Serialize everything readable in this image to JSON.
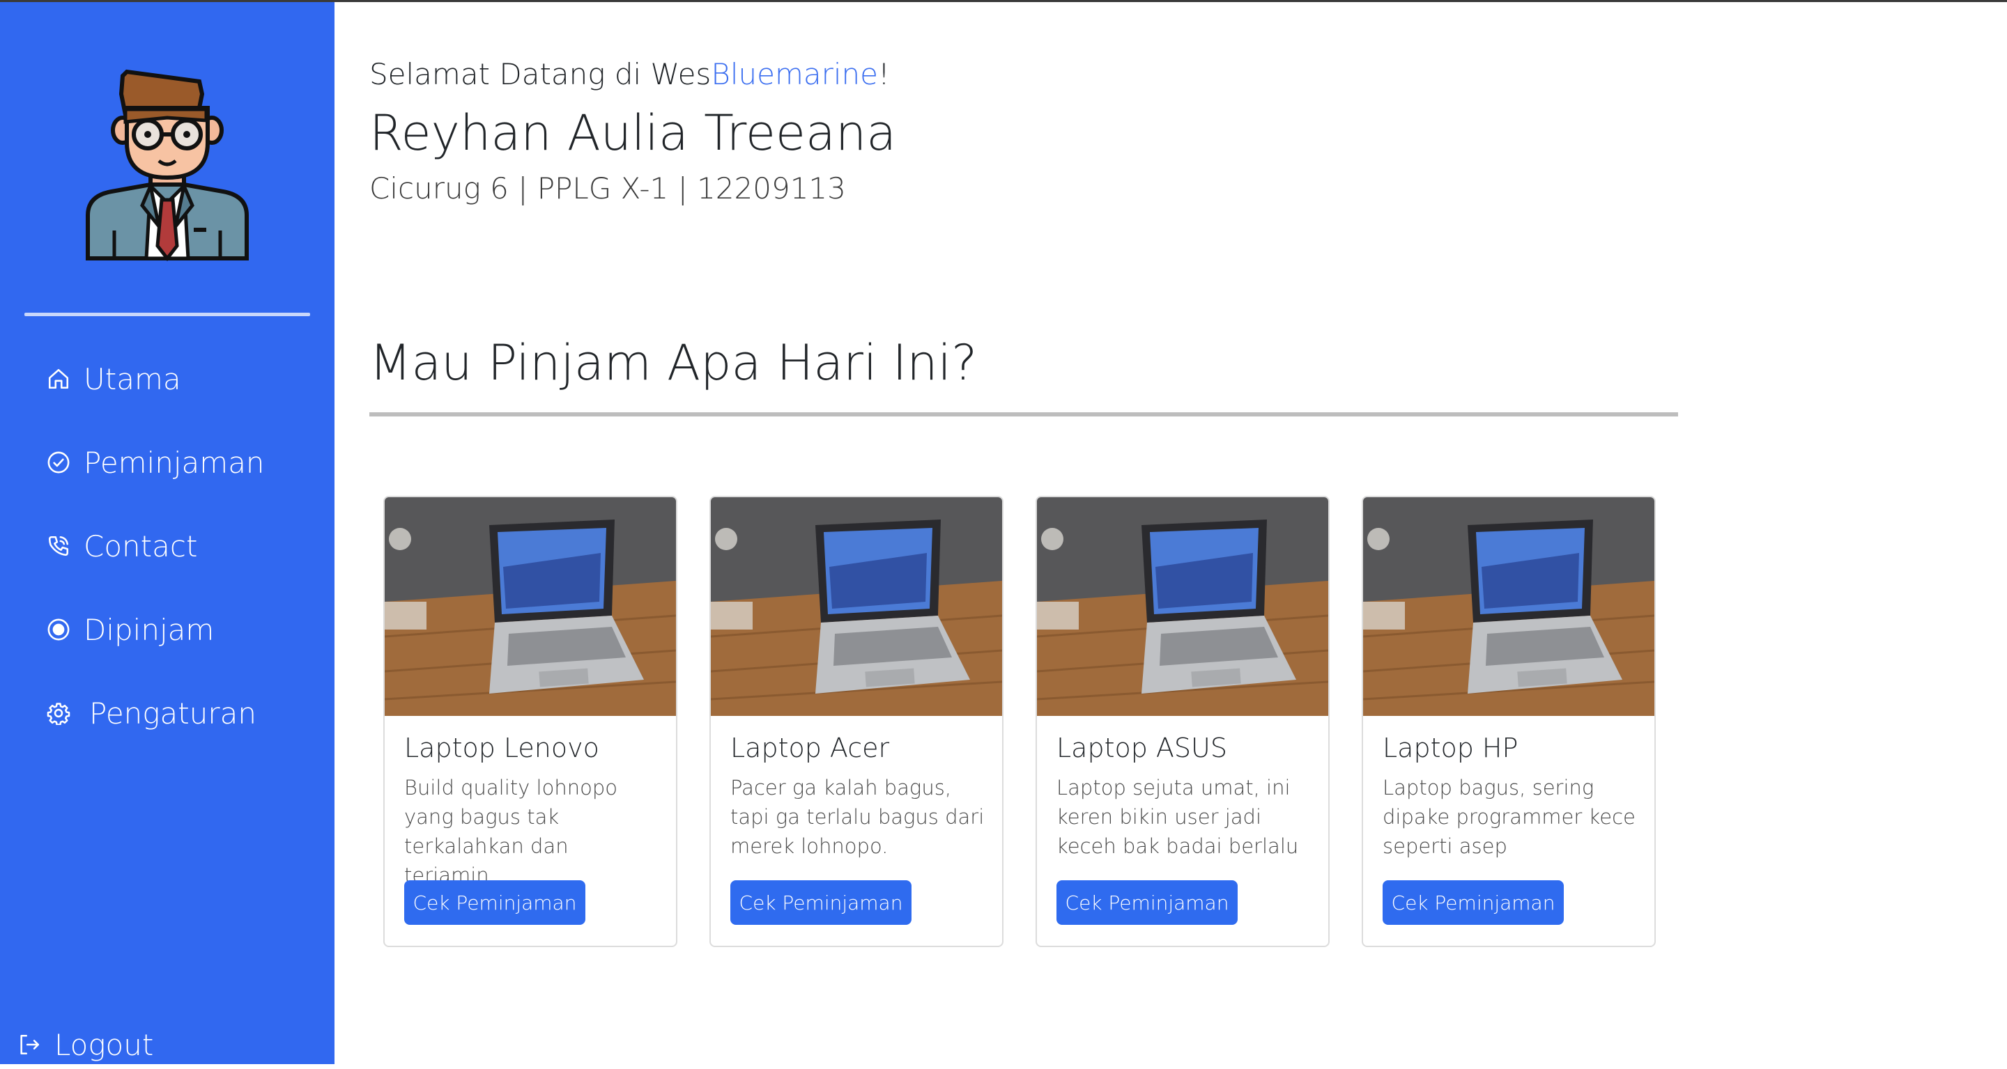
{
  "sidebar": {
    "avatar_icon": "businessman-avatar-icon",
    "nav": [
      {
        "label": "Utama",
        "icon": "home-icon"
      },
      {
        "label": "Peminjaman",
        "icon": "check-circle-icon"
      },
      {
        "label": "Contact",
        "icon": "phone-icon"
      },
      {
        "label": "Dipinjam",
        "icon": "record-circle-icon"
      },
      {
        "label": "Pengaturan",
        "icon": "gear-icon"
      }
    ],
    "logout": {
      "label": "Logout",
      "icon": "logout-icon"
    }
  },
  "header": {
    "welcome_prefix": "Selamat Datang di Wes",
    "welcome_brand": "Bluemarine",
    "welcome_suffix": "!",
    "user_name": "Reyhan Aulia Treeana",
    "user_meta": "Cicurug 6 | PPLG X-1 | 12209113"
  },
  "main": {
    "section_title": "Mau Pinjam Apa Hari Ini?",
    "cards": [
      {
        "title": "Laptop Lenovo",
        "desc": "Build quality lohnopo yang bagus tak terkalahkan dan terjamin.",
        "button": "Cek Peminjaman"
      },
      {
        "title": "Laptop Acer",
        "desc": "Pacer ga kalah bagus, tapi ga terlalu bagus dari merek lohnopo.",
        "button": "Cek Peminjaman"
      },
      {
        "title": "Laptop ASUS",
        "desc": "Laptop sejuta umat, ini keren bikin user jadi keceh bak badai berlalu",
        "button": "Cek Peminjaman"
      },
      {
        "title": "Laptop HP",
        "desc": "Laptop bagus, sering dipake programmer kece seperti asep",
        "button": "Cek Peminjaman"
      }
    ]
  },
  "colors": {
    "sidebar_bg": "#3168f0",
    "brand": "#3b6ef0",
    "button": "#2f6bef"
  }
}
